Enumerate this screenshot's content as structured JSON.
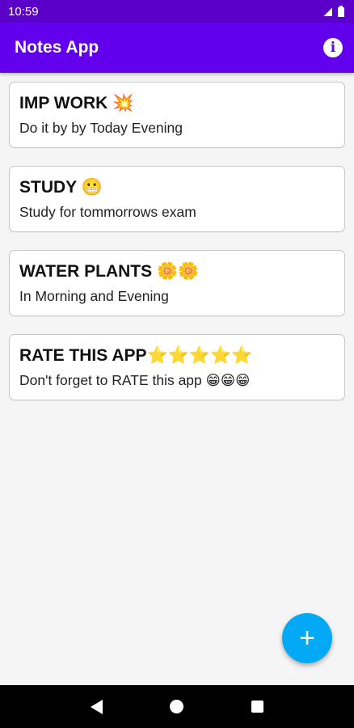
{
  "status_bar": {
    "time": "10:59"
  },
  "app_bar": {
    "title": "Notes App",
    "info_icon_glyph": "i"
  },
  "notes": [
    {
      "title": "IMP WORK 💥",
      "description": "Do it by by Today Evening"
    },
    {
      "title": "STUDY 😬",
      "description": "Study for tommorrows exam"
    },
    {
      "title": "WATER PLANTS 🌼🌼",
      "description": "In Morning and Evening"
    },
    {
      "title": "RATE THIS APP⭐⭐⭐⭐⭐",
      "description": "Don't forget to RATE this app 😁😁😁"
    }
  ],
  "fab": {
    "label": "+"
  },
  "colors": {
    "app_bar": "#6200ee",
    "status_bar": "#5a00c8",
    "fab": "#03a9f4"
  },
  "icons": [
    "signal-icon",
    "battery-icon",
    "info-icon",
    "add-icon",
    "back-icon",
    "home-icon",
    "recents-icon"
  ]
}
